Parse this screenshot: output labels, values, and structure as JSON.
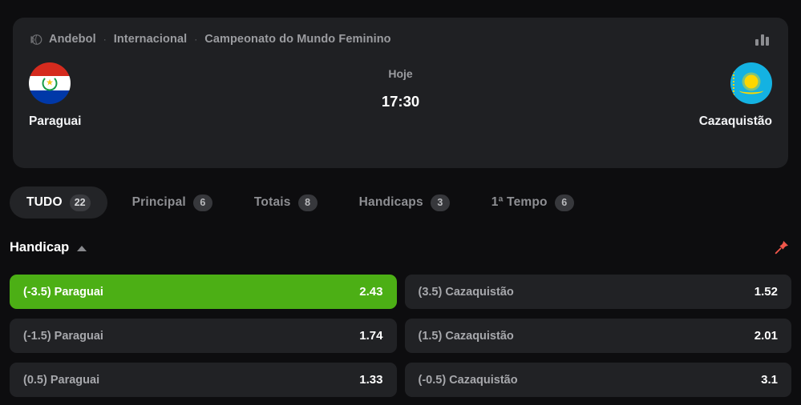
{
  "breadcrumb": {
    "icon": "handball-icon",
    "sport": "Andebol",
    "region": "Internacional",
    "competition": "Campeonato do Mundo Feminino",
    "separator": "·",
    "stats_icon": "bar-chart-icon"
  },
  "match": {
    "home": {
      "name": "Paraguai",
      "flag": "paraguay-flag"
    },
    "away": {
      "name": "Cazaquistão",
      "flag": "kazakhstan-flag"
    },
    "day_label": "Hoje",
    "time": "17:30"
  },
  "tabs": [
    {
      "label": "TUDO",
      "count": "22",
      "active": true
    },
    {
      "label": "Principal",
      "count": "6",
      "active": false
    },
    {
      "label": "Totais",
      "count": "8",
      "active": false
    },
    {
      "label": "Handicaps",
      "count": "3",
      "active": false
    },
    {
      "label": "1ª Tempo",
      "count": "6",
      "active": false
    }
  ],
  "market": {
    "title": "Handicap",
    "collapse_icon": "caret-up-icon",
    "pin_icon": "pin-icon",
    "pin_color": "#f0564a"
  },
  "bets": [
    {
      "selection": "(-3.5) Paraguai",
      "odds": "2.43",
      "selected": true
    },
    {
      "selection": "(3.5) Cazaquistão",
      "odds": "1.52",
      "selected": false
    },
    {
      "selection": "(-1.5) Paraguai",
      "odds": "1.74",
      "selected": false
    },
    {
      "selection": "(1.5) Cazaquistão",
      "odds": "2.01",
      "selected": false
    },
    {
      "selection": "(0.5) Paraguai",
      "odds": "1.33",
      "selected": false
    },
    {
      "selection": "(-0.5) Cazaquistão",
      "odds": "3.1",
      "selected": false
    }
  ],
  "colors": {
    "page_bg": "#0d0d0f",
    "card_bg": "#1f2023",
    "row_bg": "#212225",
    "accent_green": "#4caf15",
    "muted_text": "#9b9ca0"
  }
}
